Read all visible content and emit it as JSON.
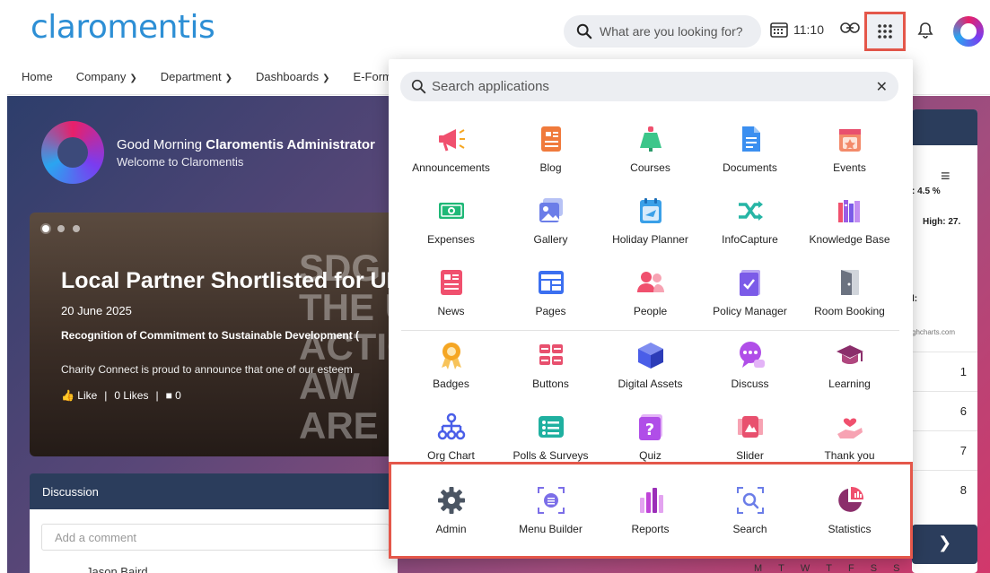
{
  "header": {
    "logo_text": "claromentis",
    "search_placeholder": "What are you looking for?",
    "time": "11:10"
  },
  "nav": {
    "items": [
      {
        "label": "Home",
        "dropdown": false
      },
      {
        "label": "Company",
        "dropdown": true
      },
      {
        "label": "Department",
        "dropdown": true
      },
      {
        "label": "Dashboards",
        "dropdown": true
      },
      {
        "label": "E-Form",
        "dropdown": false
      }
    ]
  },
  "greeting": {
    "prefix": "Good Morning ",
    "name": "Claromentis Administrator",
    "welcome": "Welcome to Claromentis"
  },
  "news": {
    "title": "Local Partner Shortlisted for UN Si",
    "date": "20 June 2025",
    "subtitle": "Recognition of Commitment to Sustainable Development (",
    "body": "Charity Connect is proud to announce that one of our esteem",
    "like_label": "Like",
    "likes_count": "0 Likes",
    "comments_count": "0",
    "bg_text_1": "SDG A",
    "bg_text_2": "THE U",
    "bg_text_3": "ACTION AW",
    "bg_text_4": "ARE E"
  },
  "discussion": {
    "title": "Discussion",
    "comment_placeholder": "Add a comment",
    "author_partial": "Jason Baird"
  },
  "widget": {
    "t1": ": 4.5 %",
    "t2": "High: 27.",
    "t3": "l:",
    "t4": "ghcharts.com",
    "rows": [
      "1",
      "6",
      "7",
      "8"
    ],
    "calendar_days": [
      "M",
      "T",
      "W",
      "T",
      "F",
      "S",
      "S"
    ]
  },
  "apps_panel": {
    "search_placeholder": "Search applications",
    "main_apps": [
      {
        "label": "Announcements",
        "icon": "megaphone-icon",
        "color": "#f0506e"
      },
      {
        "label": "Blog",
        "icon": "blog-icon",
        "color": "#f07a3c"
      },
      {
        "label": "Courses",
        "icon": "courses-icon",
        "color": "#3cc68a"
      },
      {
        "label": "Documents",
        "icon": "documents-icon",
        "color": "#3b8ff0"
      },
      {
        "label": "Events",
        "icon": "events-icon",
        "color": "#f38a6a"
      },
      {
        "label": "Expenses",
        "icon": "expenses-icon",
        "color": "#1fb877"
      },
      {
        "label": "Gallery",
        "icon": "gallery-icon",
        "color": "#6b7de8"
      },
      {
        "label": "Holiday Planner",
        "icon": "holiday-icon",
        "color": "#3aa0e8"
      },
      {
        "label": "InfoCapture",
        "icon": "shuffle-icon",
        "color": "#26b5a5"
      },
      {
        "label": "Knowledge Base",
        "icon": "books-icon",
        "color": "#9b5de5"
      },
      {
        "label": "News",
        "icon": "news-icon",
        "color": "#f0506e"
      },
      {
        "label": "Pages",
        "icon": "pages-icon",
        "color": "#3b6ff0"
      },
      {
        "label": "People",
        "icon": "people-icon",
        "color": "#f0506e"
      },
      {
        "label": "Policy Manager",
        "icon": "policy-icon",
        "color": "#7b5be8"
      },
      {
        "label": "Room Booking",
        "icon": "door-icon",
        "color": "#6b7280"
      },
      {
        "label": "Badges",
        "icon": "badge-icon",
        "color": "#f5a623"
      },
      {
        "label": "Buttons",
        "icon": "buttons-icon",
        "color": "#e8506e"
      },
      {
        "label": "Digital Assets",
        "icon": "cube-icon",
        "color": "#4a5ee8"
      },
      {
        "label": "Discuss",
        "icon": "chat-icon",
        "color": "#b04ee8"
      },
      {
        "label": "Learning",
        "icon": "graduation-cap-icon",
        "color": "#8b2e6b"
      },
      {
        "label": "Org Chart",
        "icon": "org-chart-icon",
        "color": "#4a5ee8"
      },
      {
        "label": "Polls & Surveys",
        "icon": "polls-icon",
        "color": "#1fb0a0"
      },
      {
        "label": "Quiz",
        "icon": "quiz-icon",
        "color": "#b04ee8"
      },
      {
        "label": "Slider",
        "icon": "slider-icon",
        "color": "#e8506e"
      },
      {
        "label": "Thank you",
        "icon": "thank-you-icon",
        "color": "#f0506e"
      }
    ],
    "admin_apps": [
      {
        "label": "Admin",
        "icon": "gear-icon",
        "color": "#4b5563"
      },
      {
        "label": "Menu Builder",
        "icon": "menu-builder-icon",
        "color": "#7b6ee8"
      },
      {
        "label": "Reports",
        "icon": "bar-chart-icon",
        "color": "#c044d8"
      },
      {
        "label": "Search",
        "icon": "search-icon",
        "color": "#6b7de8"
      },
      {
        "label": "Statistics",
        "icon": "pie-chart-icon",
        "color": "#8b2e6b"
      }
    ]
  }
}
